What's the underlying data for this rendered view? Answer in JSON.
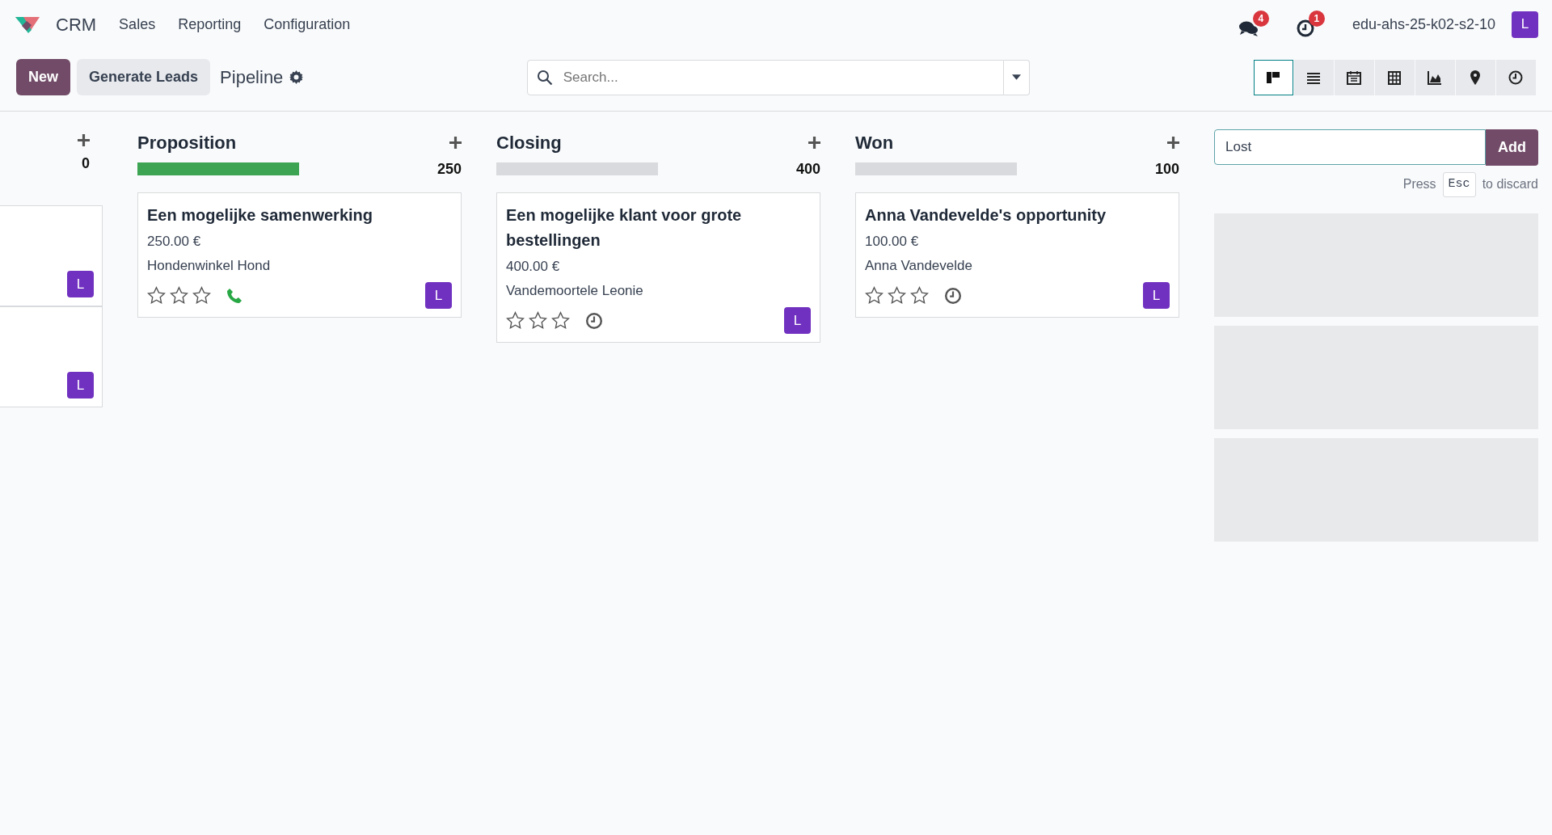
{
  "navbar": {
    "app": "CRM",
    "menus": [
      "Sales",
      "Reporting",
      "Configuration"
    ],
    "messages_badge": "4",
    "activities_badge": "1",
    "company": "edu-ahs-25-k02-s2-10",
    "avatar": "L"
  },
  "control_panel": {
    "new_button": "New",
    "generate_button": "Generate Leads",
    "breadcrumb": "Pipeline",
    "search": {
      "placeholder": "Search..."
    },
    "views": [
      {
        "kind": "kanban",
        "selected": true
      },
      {
        "kind": "list",
        "selected": false
      },
      {
        "kind": "calendar",
        "selected": false
      },
      {
        "kind": "pivot",
        "selected": false
      },
      {
        "kind": "graph",
        "selected": false
      },
      {
        "kind": "map",
        "selected": false
      },
      {
        "kind": "activity",
        "selected": false
      }
    ]
  },
  "partial_column": {
    "total": "0",
    "cards": [
      {
        "avatar": "L"
      },
      {
        "avatar": "L"
      }
    ]
  },
  "columns": [
    {
      "title": "Proposition",
      "total": "250",
      "level": 1,
      "cards": [
        {
          "title": "Een mogelijke samenwerking",
          "amount": "250.00 €",
          "customer": "Hondenwinkel Hond",
          "stars": 0,
          "activity": {
            "kind": "phone"
          },
          "avatar": "L"
        }
      ]
    },
    {
      "title": "Closing",
      "total": "400",
      "level": 0,
      "cards": [
        {
          "title": "Een mogelijke klant voor grote bestellingen",
          "amount": "400.00 €",
          "customer": "Vandemoortele Leonie",
          "stars": 0,
          "activity": {
            "kind": "clock"
          },
          "avatar": "L"
        }
      ]
    },
    {
      "title": "Won",
      "total": "100",
      "level": 0,
      "cards": [
        {
          "title": "Anna Vandevelde's opportunity",
          "amount": "100.00 €",
          "customer": "Anna Vandevelde",
          "stars": 0,
          "activity": {
            "kind": "clock"
          },
          "avatar": "L"
        }
      ]
    }
  ],
  "new_column": {
    "value": "Lost",
    "add_button": "Add",
    "hint_before": "Press",
    "hint_key": "Esc",
    "hint_after": "to discard"
  }
}
